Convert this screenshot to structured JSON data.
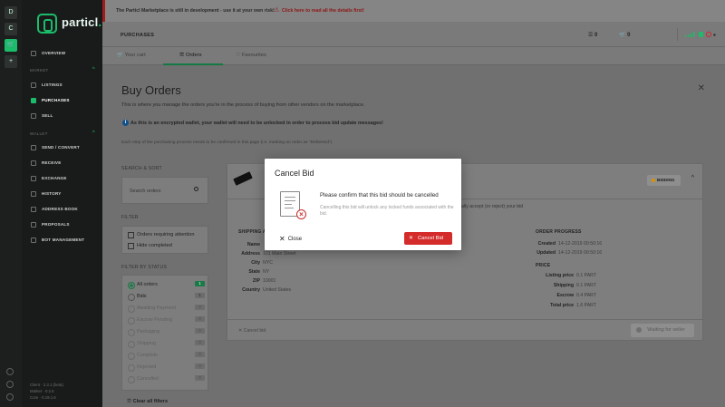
{
  "rail": {
    "workspaces": [
      "D",
      "C"
    ],
    "add": "+"
  },
  "sidebar": {
    "brand": "particl",
    "overview": "OVERVIEW",
    "market_header": "MARKET",
    "market_items": [
      "LISTINGS",
      "PURCHASES",
      "SELL"
    ],
    "wallet_header": "WALLET",
    "wallet_items": [
      "SEND / CONVERT",
      "RECEIVE",
      "EXCHANGE",
      "HISTORY",
      "ADDRESS BOOK",
      "PROPOSALS",
      "BOT MANAGEMENT"
    ],
    "versions": [
      "Client · 2.3.1 (beta)",
      "Market · 0.2.6",
      "Core · 0.19.1.6"
    ]
  },
  "banner": {
    "notice": "The Particl Marketplace is still in development - use it at your own risk!",
    "link": "Click here to read all the details first!"
  },
  "header": {
    "title": "PURCHASES",
    "bids_count": "0",
    "cart_count": "0"
  },
  "tabs": [
    "Your cart",
    "Orders",
    "Favourites"
  ],
  "page": {
    "title": "Buy Orders",
    "subtitle": "This is where you manage the orders you're in the process of buying from other vendors on the marketplace.",
    "info": "As this is an encrypted wallet, your wallet will need to be unlocked in order to process bid update messages!",
    "steps": "Each step of the purchasing process needs to be confirmed in this page (i.e. marking an order as \"Delivered\")."
  },
  "filters": {
    "search_sort_label": "SEARCH & SORT",
    "search_placeholder": "Search orders",
    "filter_label": "FILTER",
    "filter_options": [
      "Orders requiring attention",
      "Hide completed"
    ],
    "status_label": "FILTER BY STATUS",
    "statuses": [
      {
        "label": "All orders",
        "count": "1"
      },
      {
        "label": "Bids",
        "count": "1"
      },
      {
        "label": "Awaiting Payment",
        "count": "0"
      },
      {
        "label": "Escrow Pending",
        "count": "0"
      },
      {
        "label": "Packaging",
        "count": "0"
      },
      {
        "label": "Shipping",
        "count": "0"
      },
      {
        "label": "Complete",
        "count": "0"
      },
      {
        "label": "Rejected",
        "count": "0"
      },
      {
        "label": "Cancelled",
        "count": "0"
      }
    ],
    "clear": "Clear all filters"
  },
  "order": {
    "status": "BIDDING",
    "accept_text": "ally accept (or reject) your bid",
    "shipping_header": "SHIPPING A",
    "shipping": [
      {
        "k": "Name",
        "v": ""
      },
      {
        "k": "Address",
        "v": "101 Main Street"
      },
      {
        "k": "City",
        "v": "NYC"
      },
      {
        "k": "State",
        "v": "NY"
      },
      {
        "k": "ZIP",
        "v": "10001"
      },
      {
        "k": "Country",
        "v": "United States"
      }
    ],
    "progress_header": "ORDER PROGRESS",
    "progress": [
      {
        "k": "Created",
        "v": "14-12-2019 00:50:16"
      },
      {
        "k": "Updated",
        "v": "14-12-2019 00:50:16"
      }
    ],
    "price_header": "PRICE",
    "price": [
      {
        "k": "Listing price",
        "v": "0.1 PART"
      },
      {
        "k": "Shipping",
        "v": "0.1 PART"
      },
      {
        "k": "Escrow",
        "v": "0.4 PART"
      },
      {
        "k": "Total price",
        "v": "1.6 PART"
      }
    ],
    "cancel_link": "Cancel bid",
    "waiting": "Waiting for seller"
  },
  "modal": {
    "title": "Cancel Bid",
    "message": "Please confirm that this bid should be cancelled",
    "note": "Cancelling this bid will unlock any locked funds associated with the bid.",
    "close": "Close",
    "confirm": "Cancel Bid"
  },
  "colors": {
    "brand": "#1bbc6a",
    "danger": "#d42b2b",
    "info": "#13508a",
    "pending": "#d89200"
  }
}
